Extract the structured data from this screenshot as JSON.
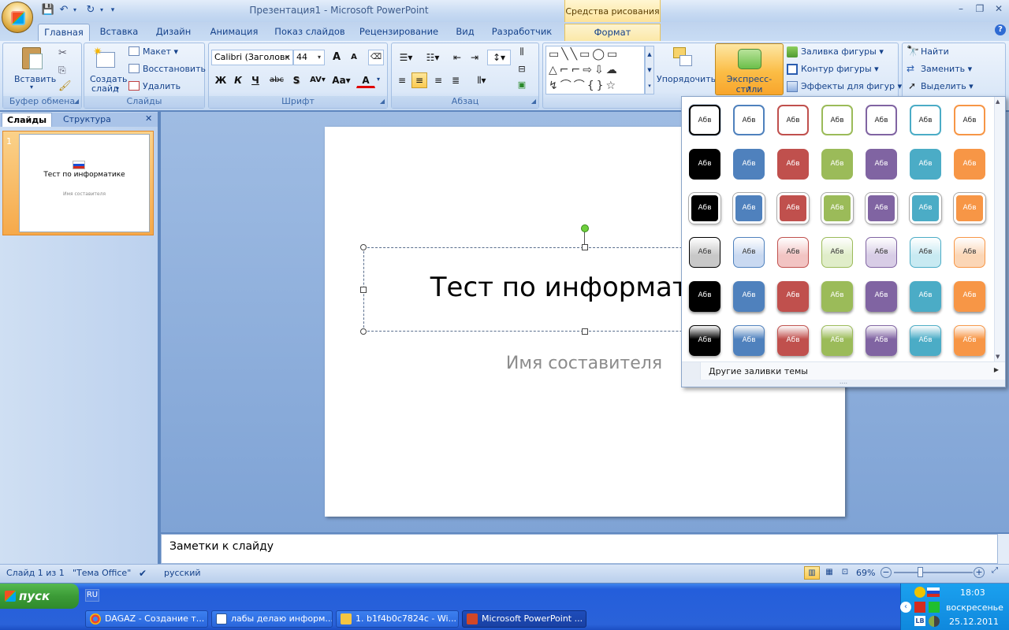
{
  "window": {
    "title": "Презентация1 - Microsoft PowerPoint",
    "context_group": "Средства рисования"
  },
  "tabs": [
    "Главная",
    "Вставка",
    "Дизайн",
    "Анимация",
    "Показ слайдов",
    "Рецензирование",
    "Вид",
    "Разработчик",
    "Формат"
  ],
  "active_tab": "Главная",
  "ribbon": {
    "clipboard": {
      "label": "Буфер обмена",
      "paste": "Вставить"
    },
    "slides": {
      "label": "Слайды",
      "new_slide_1": "Создать",
      "new_slide_2": "слайд",
      "layout": "Макет",
      "reset": "Восстановить",
      "delete": "Удалить"
    },
    "font": {
      "label": "Шрифт",
      "font_name": "Calibri (Заголовк",
      "font_size": "44",
      "bold": "Ж",
      "italic": "К",
      "underline": "Ч",
      "strike": "abc",
      "shadow": "S",
      "spacing": "AV",
      "case": "Aa",
      "color_letter": "A",
      "grow": "A",
      "shrink": "A"
    },
    "paragraph": {
      "label": "Абзац"
    },
    "drawing": {
      "arrange": "Упорядочить",
      "quick_styles": "Экспресс-стили",
      "shape_fill": "Заливка фигуры",
      "shape_outline": "Контур фигуры",
      "shape_effects": "Эффекты для фигур"
    },
    "editing": {
      "find": "Найти",
      "replace": "Заменить",
      "select": "Выделить"
    }
  },
  "panel": {
    "tabs": [
      "Слайды",
      "Структура"
    ],
    "slide_number": "1",
    "thumb_title": "Тест по информатике",
    "thumb_subtitle": "Имя составителя"
  },
  "slide": {
    "title": "Тест по информатике",
    "subtitle": "Имя составителя"
  },
  "notes": {
    "placeholder": "Заметки к слайду"
  },
  "gallery": {
    "sample_text": "Абв",
    "colors": [
      "#000000",
      "#4f81bd",
      "#c0504d",
      "#9bbb59",
      "#8064a2",
      "#4bacc6",
      "#f79646"
    ],
    "light_colors": [
      "#c8c8c8",
      "#c9d9f1",
      "#f2c4c3",
      "#e0edc9",
      "#d8cde6",
      "#c8eaf2",
      "#fbd6b6"
    ],
    "more_fills": "Другие заливки темы"
  },
  "status": {
    "slide": "Слайд 1 из 1",
    "theme": "\"Тема Office\"",
    "language": "русский",
    "zoom": "69%"
  },
  "taskbar": {
    "start": "пуск",
    "lang": "RU",
    "tasks": [
      "DAGAZ - Создание т...",
      "лабы делаю информ...",
      "1. b1f4b0c7824c - Wi...",
      "Microsoft PowerPoint ..."
    ],
    "time": "18:03",
    "day": "воскресенье",
    "date": "25.12.2011"
  }
}
